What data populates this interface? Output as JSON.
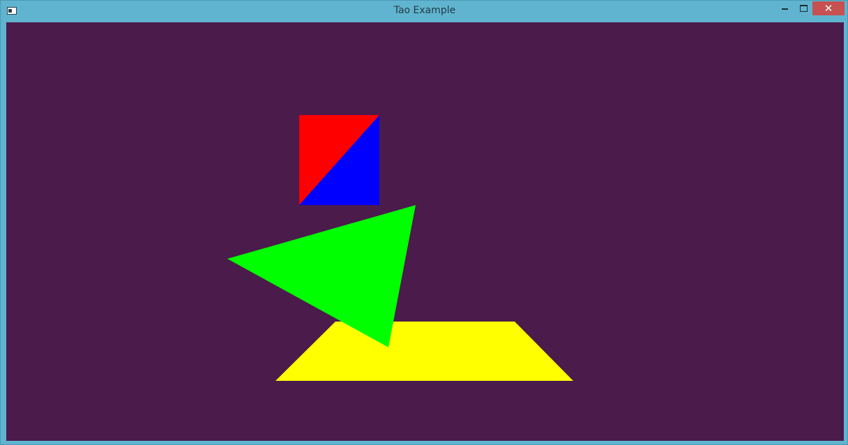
{
  "window": {
    "title": "Tao Example",
    "app_icon": "window-app-icon",
    "controls": {
      "minimize_icon": "minimize-icon",
      "maximize_icon": "maximize-icon",
      "close_icon": "close-icon",
      "close_glyph": "✕"
    }
  },
  "scene": {
    "background_color": "#4a1b4b",
    "shapes": [
      {
        "name": "red-triangle",
        "color": "#ff0000"
      },
      {
        "name": "blue-triangle",
        "color": "#0000ff"
      },
      {
        "name": "yellow-trapezoid",
        "color": "#ffff00"
      },
      {
        "name": "green-triangle",
        "color": "#00ff00"
      }
    ]
  }
}
